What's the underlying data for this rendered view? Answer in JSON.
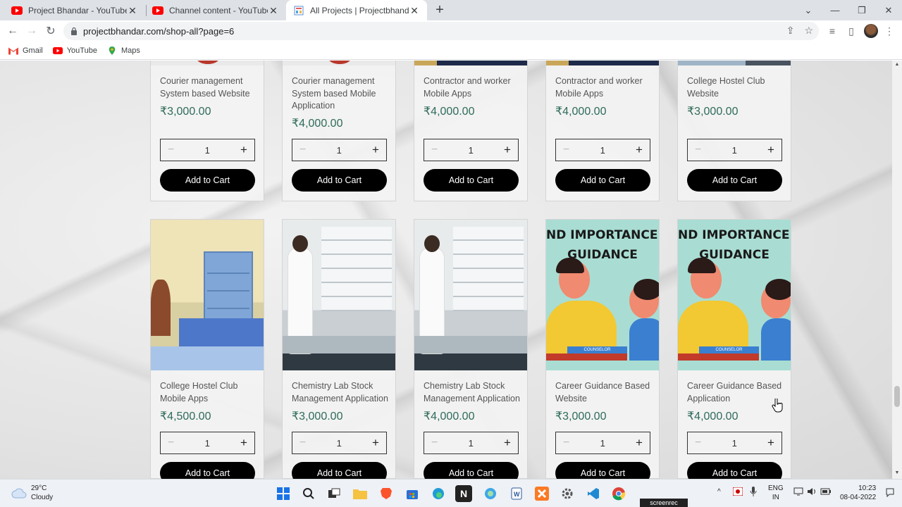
{
  "browser": {
    "tabs": [
      {
        "title": "Project Bhandar - YouTube",
        "icon": "youtube-icon",
        "active": false
      },
      {
        "title": "Channel content - YouTube Studio",
        "icon": "youtube-icon",
        "active": false
      },
      {
        "title": "All Projects | Projectbhandar",
        "icon": "site-icon",
        "active": true
      }
    ],
    "url": "projectbhandar.com/shop-all?page=6",
    "bookmarks": [
      {
        "label": "Gmail",
        "icon": "gmail-icon"
      },
      {
        "label": "YouTube",
        "icon": "youtube-icon"
      },
      {
        "label": "Maps",
        "icon": "maps-icon"
      }
    ]
  },
  "products_row1": [
    {
      "name": "Courier management System based Website",
      "price": "₹3,000.00",
      "qty": "1",
      "button": "Add to Cart"
    },
    {
      "name": "Courier management System based Mobile Application",
      "price": "₹4,000.00",
      "qty": "1",
      "button": "Add to Cart"
    },
    {
      "name": "Contractor and worker Mobile Apps",
      "price": "₹4,000.00",
      "qty": "1",
      "button": "Add to Cart"
    },
    {
      "name": "Contractor and worker Mobile Apps",
      "price": "₹4,000.00",
      "qty": "1",
      "button": "Add to Cart"
    },
    {
      "name": "College Hostel Club Website",
      "price": "₹3,000.00",
      "qty": "1",
      "button": "Add to Cart"
    }
  ],
  "products_row2": [
    {
      "name": "College Hostel Club Mobile Apps",
      "price": "₹4,500.00",
      "qty": "1",
      "button": "Add to Cart",
      "art": "hostel"
    },
    {
      "name": "Chemistry Lab Stock Management Application",
      "price": "₹3,000.00",
      "qty": "1",
      "button": "Add to Cart",
      "art": "lab"
    },
    {
      "name": "Chemistry Lab Stock Management Application",
      "price": "₹4,000.00",
      "qty": "1",
      "button": "Add to Cart",
      "art": "lab"
    },
    {
      "name": "Career Guidance Based Website",
      "price": "₹3,000.00",
      "qty": "1",
      "button": "Add to Cart",
      "art": "career"
    },
    {
      "name": "Career Guidance Based Application",
      "price": "₹4,000.00",
      "qty": "1",
      "button": "Add to Cart",
      "art": "career"
    }
  ],
  "career_art": {
    "line1": "ND IMPORTANCE OF C",
    "line2": "GUIDANCE",
    "sign": "COUNSELOR"
  },
  "taskbar": {
    "temperature": "29°C",
    "weather": "Cloudy",
    "language": "ENG",
    "region": "IN",
    "time": "10:23",
    "date": "08-04-2022",
    "recorder": "screenrec"
  },
  "colors": {
    "price": "#2e6b5a",
    "button": "#000000",
    "accent": "#1a73e8"
  }
}
